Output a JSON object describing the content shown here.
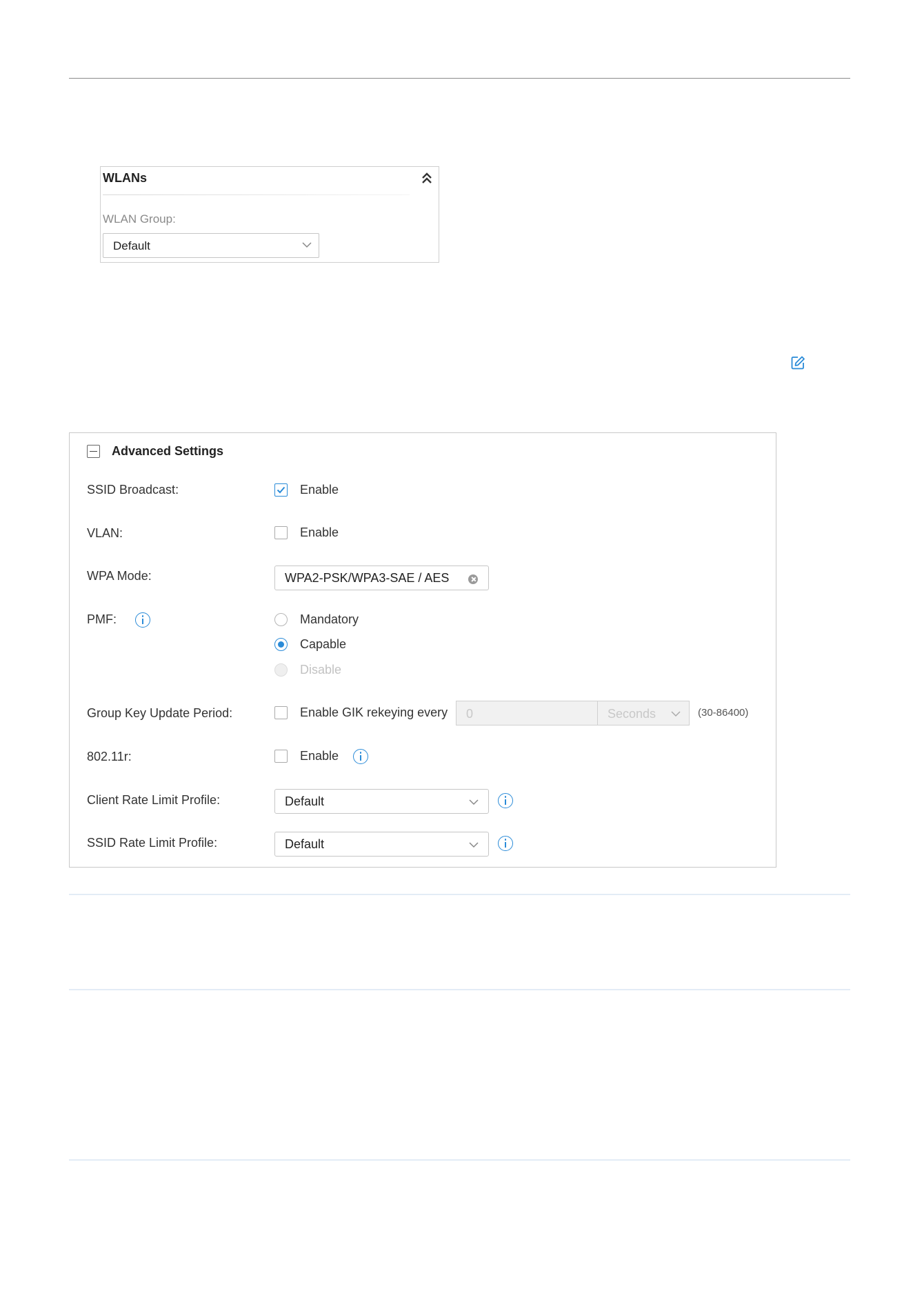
{
  "wlans_panel": {
    "title": "WLANs",
    "group_label": "WLAN Group:",
    "group_value": "Default"
  },
  "advanced": {
    "title": "Advanced Settings",
    "ssid_broadcast": {
      "label": "SSID Broadcast",
      "option": "Enable",
      "checked": true
    },
    "vlan": {
      "label": "VLAN",
      "option": "Enable",
      "checked": false
    },
    "wpa_mode": {
      "label": "WPA Mode",
      "value": "WPA2-PSK/WPA3-SAE / AES"
    },
    "pmf": {
      "label": "PMF",
      "options": [
        "Mandatory",
        "Capable",
        "Disable"
      ],
      "selected": "Capable",
      "disabled": [
        "Disable"
      ]
    },
    "group_key": {
      "label": "Group Key Update Period",
      "option": "Enable GIK rekeying every",
      "checked": false,
      "value": "0",
      "unit": "Seconds",
      "range": "(30-86400)"
    },
    "dot11r": {
      "label": "802.11r",
      "option": "Enable",
      "checked": false
    },
    "client_rate_limit": {
      "label": "Client Rate Limit Profile",
      "value": "Default"
    },
    "ssid_rate_limit": {
      "label": "SSID Rate Limit Profile",
      "value": "Default"
    }
  },
  "colors": {
    "accent": "#2a8bd8",
    "border": "#c8c8c8",
    "disabled_text": "#c2c2c2"
  }
}
